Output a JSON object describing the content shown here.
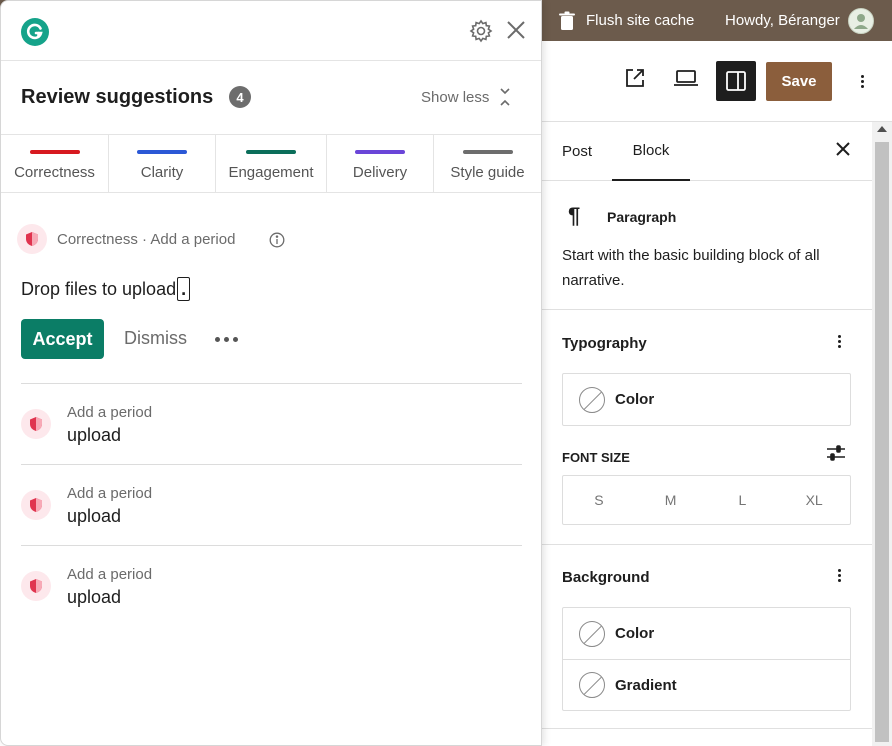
{
  "wp": {
    "adminbar": {
      "flush_label": "Flush site cache",
      "howdy_label": "Howdy, Béranger"
    },
    "toolbar": {
      "save_label": "Save"
    },
    "sidebar": {
      "tabs": [
        {
          "label": "Post"
        },
        {
          "label": "Block"
        }
      ],
      "block": {
        "icon_glyph": "¶",
        "name": "Paragraph",
        "description": "Start with the basic building block of all narrative."
      },
      "typography": {
        "title": "Typography",
        "color_label": "Color",
        "font_size_label": "FONT SIZE",
        "sizes": [
          "S",
          "M",
          "L",
          "XL"
        ]
      },
      "background": {
        "title": "Background",
        "color_label": "Color",
        "gradient_label": "Gradient"
      }
    }
  },
  "grammarly": {
    "header": {
      "title": "Review suggestions",
      "count": "4",
      "show_less_label": "Show less"
    },
    "categories": [
      {
        "label": "Correctness",
        "color": "#d71920"
      },
      {
        "label": "Clarity",
        "color": "#2b58d6"
      },
      {
        "label": "Engagement",
        "color": "#0b6e5a"
      },
      {
        "label": "Delivery",
        "color": "#6a45d8"
      },
      {
        "label": "Style guide",
        "color": "#6d6d6d"
      }
    ],
    "main_suggestion": {
      "label": "Correctness · Add a period",
      "sentence": "Drop files to upload",
      "period": ".",
      "accept_label": "Accept",
      "dismiss_label": "Dismiss"
    },
    "suggestions": [
      {
        "label": "Add a period",
        "word": "upload"
      },
      {
        "label": "Add a period",
        "word": "upload"
      },
      {
        "label": "Add a period",
        "word": "upload"
      }
    ],
    "colors": {
      "brand": "#15a38a",
      "accept": "#0b7d66",
      "shield": "#e0344f"
    }
  }
}
